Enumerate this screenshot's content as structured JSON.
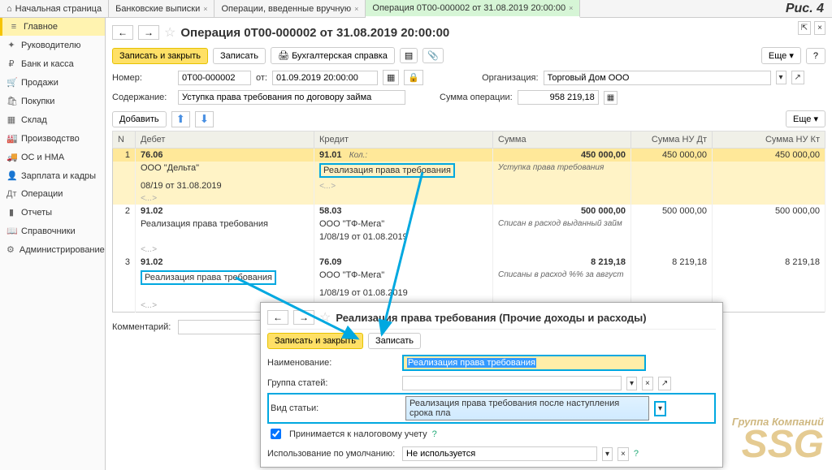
{
  "figure": "Рис. 4",
  "tabs": [
    {
      "label": "Начальная страница",
      "icon": "⌂"
    },
    {
      "label": "Банковские выписки"
    },
    {
      "label": "Операции, введенные вручную"
    },
    {
      "label": "Операция 0Т00-000002 от 31.08.2019 20:00:00",
      "active": true
    }
  ],
  "sidebar": [
    {
      "icon": "≡",
      "label": "Главное",
      "active": true
    },
    {
      "icon": "✦",
      "label": "Руководителю"
    },
    {
      "icon": "₽",
      "label": "Банк и касса"
    },
    {
      "icon": "🛒",
      "label": "Продажи"
    },
    {
      "icon": "🛍",
      "label": "Покупки"
    },
    {
      "icon": "▦",
      "label": "Склад"
    },
    {
      "icon": "🏭",
      "label": "Производство"
    },
    {
      "icon": "🚚",
      "label": "ОС и НМА"
    },
    {
      "icon": "👤",
      "label": "Зарплата и кадры"
    },
    {
      "icon": "Дт",
      "label": "Операции"
    },
    {
      "icon": "▮",
      "label": "Отчеты"
    },
    {
      "icon": "📖",
      "label": "Справочники"
    },
    {
      "icon": "⚙",
      "label": "Администрирование"
    }
  ],
  "title": "Операция 0Т00-000002 от 31.08.2019 20:00:00",
  "toolbar": {
    "save_close": "Записать и закрыть",
    "save": "Записать",
    "acc_ref": "Бухгалтерская справка",
    "more": "Еще",
    "help": "?"
  },
  "form": {
    "number_label": "Номер:",
    "number": "0Т00-000002",
    "from_label": "от:",
    "date": "01.09.2019 20:00:00",
    "org_label": "Организация:",
    "org": "Торговый Дом ООО",
    "content_label": "Содержание:",
    "content": "Уступка права требования по договору займа",
    "sum_label": "Сумма операции:",
    "sum": "958 219,18"
  },
  "grid_toolbar": {
    "add": "Добавить",
    "more": "Еще"
  },
  "grid": {
    "headers": {
      "n": "N",
      "debit": "Дебет",
      "credit": "Кредит",
      "sum": "Сумма",
      "nu_dt": "Сумма НУ Дт",
      "nu_kt": "Сумма НУ Кт"
    },
    "rows": [
      {
        "n": "1",
        "selected": true,
        "d_acct": "76.06",
        "d_sub1": "ООО \"Дельта\"",
        "d_sub2": "08/19 от 31.08.2019",
        "c_acct": "91.01",
        "c_kol": "Кол.:",
        "c_sub1": "Реализация права требования",
        "hl_credit": true,
        "sum": "450 000,00",
        "note": "Уступка права требования",
        "nu_dt": "450 000,00",
        "nu_kt": "450 000,00"
      },
      {
        "n": "2",
        "d_acct": "91.02",
        "d_sub1": "Реализация права требования",
        "c_acct": "58.03",
        "c_sub1": "ООО \"ТФ-Мега\"",
        "c_sub2": "1/08/19 от 01.08.2019",
        "sum": "500 000,00",
        "note": "Списан в расход выданный займ",
        "nu_dt": "500 000,00",
        "nu_kt": "500 000,00"
      },
      {
        "n": "3",
        "d_acct": "91.02",
        "d_sub1": "Реализация права требования",
        "hl_debit": true,
        "c_acct": "76.09",
        "c_sub1": "ООО \"ТФ-Мега\"",
        "c_sub2": "1/08/19 от 01.08.2019",
        "sum": "8 219,18",
        "note": "Списаны в расход %% за август",
        "nu_dt": "8 219,18",
        "nu_kt": "8 219,18"
      }
    ],
    "etc": "<...>"
  },
  "comment_label": "Комментарий:",
  "popup": {
    "title": "Реализация права требования (Прочие доходы и расходы)",
    "save_close": "Записать и закрыть",
    "save": "Записать",
    "name_label": "Наименование:",
    "name_value": "Реализация права требования",
    "group_label": "Группа статей:",
    "type_label": "Вид статьи:",
    "type_value": "Реализация права требования после наступления срока пла",
    "tax_label": "Принимается к налоговому учету",
    "default_label": "Использование по умолчанию:",
    "default_value": "Не используется"
  },
  "watermark": {
    "small": "Группа Компаний",
    "big": "SSG"
  }
}
